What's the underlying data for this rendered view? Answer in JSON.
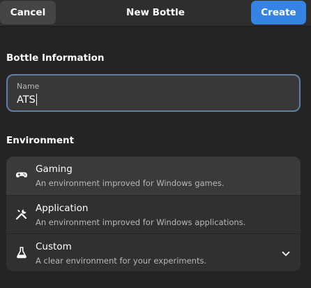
{
  "header": {
    "title": "New Bottle",
    "cancel_label": "Cancel",
    "create_label": "Create"
  },
  "bottle_info": {
    "section_title": "Bottle Information",
    "name_label": "Name",
    "name_value": "ATS"
  },
  "environment": {
    "section_title": "Environment",
    "options": [
      {
        "title": "Gaming",
        "subtitle": "An environment improved for Windows games.",
        "icon": "gamepad-icon",
        "selected": true
      },
      {
        "title": "Application",
        "subtitle": "An environment improved for Windows applications.",
        "icon": "tools-icon",
        "selected": false
      },
      {
        "title": "Custom",
        "subtitle": "A clear environment for your experiments.",
        "icon": "flask-icon",
        "selected": false,
        "expandable": true
      }
    ]
  },
  "colors": {
    "accent": "#3584e4",
    "background": "#242424",
    "header": "#2e2e2e",
    "focus_border": "#5b7fa8"
  }
}
